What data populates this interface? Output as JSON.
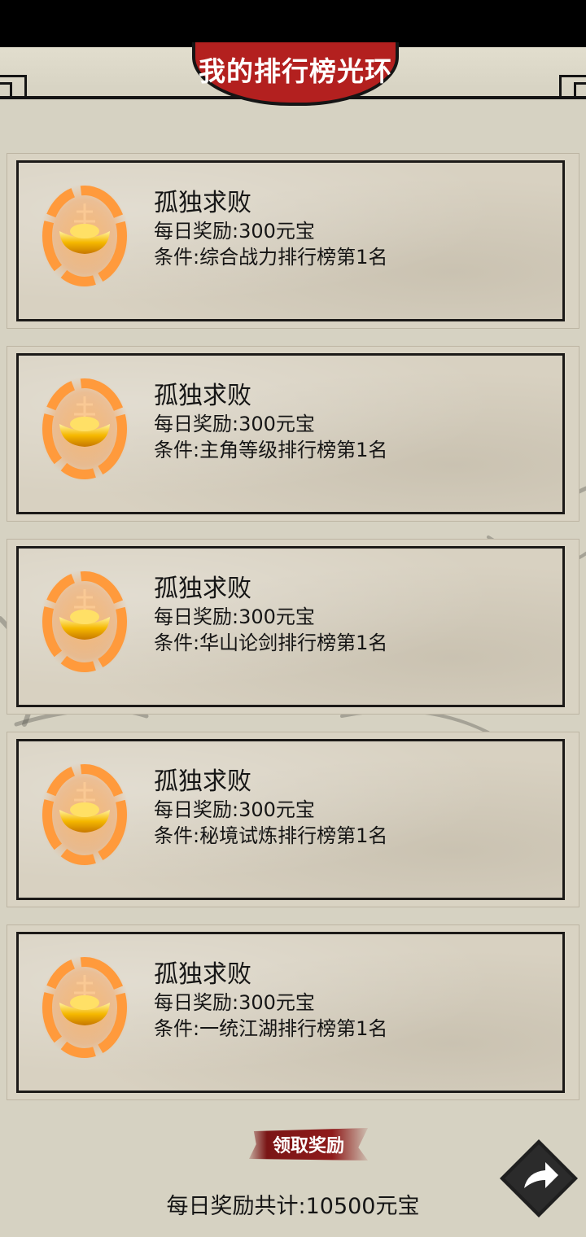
{
  "header": {
    "title": "我的排行榜光环"
  },
  "cards": [
    {
      "title": "孤独求败",
      "reward": "每日奖励:300元宝",
      "condition": "条件:综合战力排行榜第1名",
      "icon": "gold-ingot-halo-icon"
    },
    {
      "title": "孤独求败",
      "reward": "每日奖励:300元宝",
      "condition": "条件:主角等级排行榜第1名",
      "icon": "gold-ingot-halo-icon"
    },
    {
      "title": "孤独求败",
      "reward": "每日奖励:300元宝",
      "condition": "条件:华山论剑排行榜第1名",
      "icon": "gold-ingot-halo-icon"
    },
    {
      "title": "孤独求败",
      "reward": "每日奖励:300元宝",
      "condition": "条件:秘境试炼排行榜第1名",
      "icon": "gold-ingot-halo-icon"
    },
    {
      "title": "孤独求败",
      "reward": "每日奖励:300元宝",
      "condition": "条件:一统江湖排行榜第1名",
      "icon": "gold-ingot-halo-icon"
    }
  ],
  "footer": {
    "claim_label": "领取奖励",
    "total_text": "每日奖励共计:10500元宝",
    "share_icon": "share-arrow-icon"
  },
  "colors": {
    "accent": "#b3201f",
    "button": "#8f1b1b",
    "halo": "#ff8a2a",
    "gold": "#f5b800"
  }
}
